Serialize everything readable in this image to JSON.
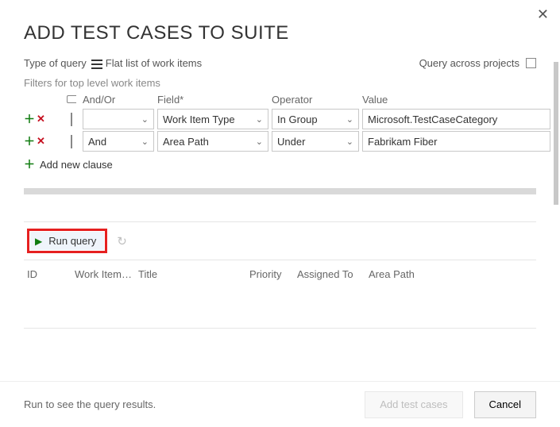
{
  "title": "ADD TEST CASES TO SUITE",
  "top": {
    "type_label": "Type of query",
    "type_value": "Flat list of work items",
    "across_label": "Query across projects"
  },
  "filters": {
    "section_label": "Filters for top level work items",
    "headers": {
      "andor": "And/Or",
      "field": "Field*",
      "operator": "Operator",
      "value": "Value"
    },
    "rows": [
      {
        "andor": "",
        "field": "Work Item Type",
        "operator": "In Group",
        "value": "Microsoft.TestCaseCategory"
      },
      {
        "andor": "And",
        "field": "Area Path",
        "operator": "Under",
        "value": "Fabrikam Fiber"
      }
    ],
    "add_new": "Add new clause"
  },
  "toolbar": {
    "run": "Run query"
  },
  "columns": {
    "id": "ID",
    "wit": "Work Item…",
    "title": "Title",
    "priority": "Priority",
    "assigned": "Assigned To",
    "area": "Area Path"
  },
  "footer": {
    "message": "Run to see the query results.",
    "add": "Add test cases",
    "cancel": "Cancel"
  }
}
